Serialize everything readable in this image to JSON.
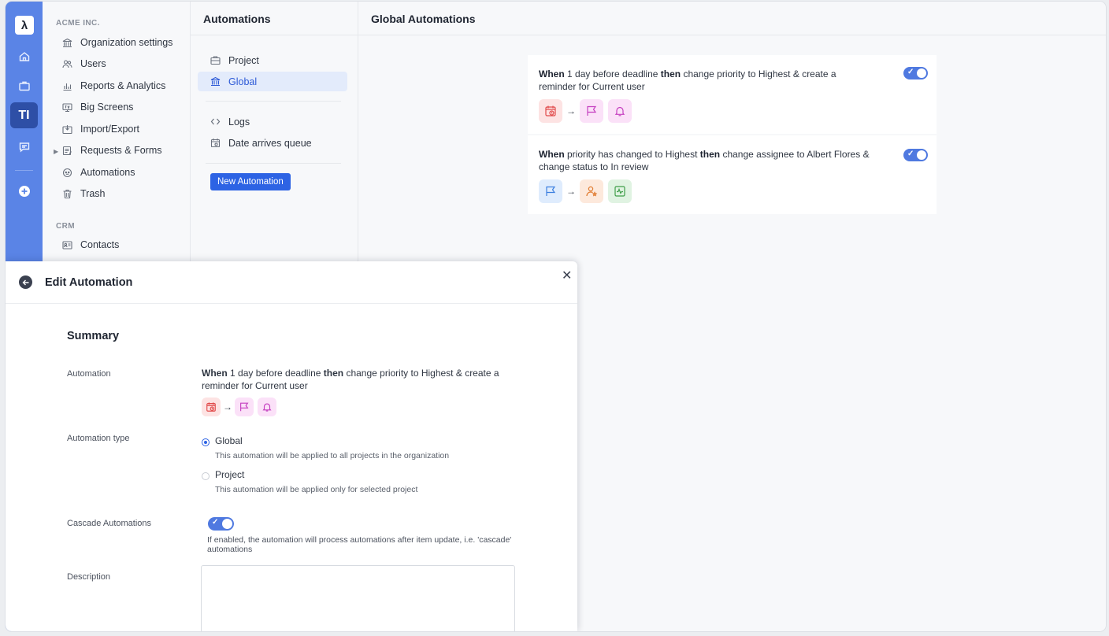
{
  "rail": {
    "logo": "λ",
    "items": [
      "home",
      "briefcase",
      "TI",
      "chat",
      "add"
    ]
  },
  "nav": {
    "org_heading": "ACME INC.",
    "org_items": [
      {
        "label": "Organization settings",
        "icon": "bank-icon"
      },
      {
        "label": "Users",
        "icon": "users-icon"
      },
      {
        "label": "Reports & Analytics",
        "icon": "chart-icon"
      },
      {
        "label": "Big Screens",
        "icon": "tv-icon"
      },
      {
        "label": "Import/Export",
        "icon": "import-icon"
      },
      {
        "label": "Requests & Forms",
        "icon": "form-icon"
      },
      {
        "label": "Automations",
        "icon": "robot-icon"
      },
      {
        "label": "Trash",
        "icon": "trash-icon"
      }
    ],
    "crm_heading": "CRM",
    "crm_items": [
      {
        "label": "Contacts",
        "icon": "contact-card-icon"
      }
    ]
  },
  "list": {
    "title": "Automations",
    "items": [
      {
        "label": "Project",
        "icon": "briefcase-icon"
      },
      {
        "label": "Global",
        "icon": "bank-icon"
      },
      {
        "label": "Logs",
        "icon": "code-icon"
      },
      {
        "label": "Date arrives queue",
        "icon": "calendar-icon"
      }
    ],
    "new_button": "New Automation"
  },
  "main": {
    "title": "Global Automations",
    "cards": [
      {
        "when": "When",
        "trigger": " 1 day before deadline ",
        "then": "then",
        "action": " change priority to Highest & create a reminder for Current user",
        "enabled": true,
        "chips": [
          {
            "icon": "calendar-clock-icon",
            "color": "#e14b4b",
            "bg": "#fde3e3"
          },
          {
            "icon": "flag-icon",
            "color": "#c53fc0",
            "bg": "#fbe1f8"
          },
          {
            "icon": "bell-icon",
            "color": "#c53fc0",
            "bg": "#fbe1f8"
          }
        ]
      },
      {
        "when": "When",
        "trigger": " priority has changed to Highest ",
        "then": "then",
        "action": " change assignee to Albert Flores & change status to In review",
        "enabled": true,
        "chips": [
          {
            "icon": "flag-icon",
            "color": "#3d80e0",
            "bg": "#dfecfd"
          },
          {
            "icon": "assignee-icon",
            "color": "#e07a2f",
            "bg": "#fde9dc"
          },
          {
            "icon": "status-icon",
            "color": "#3f9e4a",
            "bg": "#e0f3e2"
          }
        ]
      }
    ]
  },
  "panel": {
    "title": "Edit Automation",
    "summary": "Summary",
    "automation_label": "Automation",
    "automation": {
      "when": "When",
      "trigger": " 1 day before deadline ",
      "then": "then",
      "action": " change priority to Highest & create a reminder for Current user"
    },
    "type_label": "Automation type",
    "type_options": [
      {
        "label": "Global",
        "desc": "This automation will be applied to all projects in the organization",
        "selected": true
      },
      {
        "label": "Project",
        "desc": "This automation will be applied only for selected project",
        "selected": false
      }
    ],
    "cascade_label": "Cascade Automations",
    "cascade_enabled": true,
    "cascade_desc": "If enabled, the automation will process automations after item update, i.e. 'cascade' automations",
    "description_label": "Description",
    "description_value": ""
  }
}
